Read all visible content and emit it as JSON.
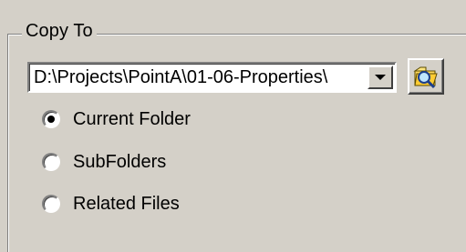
{
  "group": {
    "title": "Copy To"
  },
  "destination": {
    "path": "D:\\Projects\\PointA\\01-06-Properties\\",
    "dropdown_icon": "chevron-down-icon",
    "browse_icon": "folder-search-icon"
  },
  "options": [
    {
      "label": "Current Folder",
      "selected": true
    },
    {
      "label": "SubFolders",
      "selected": false
    },
    {
      "label": "Related Files",
      "selected": false
    }
  ]
}
